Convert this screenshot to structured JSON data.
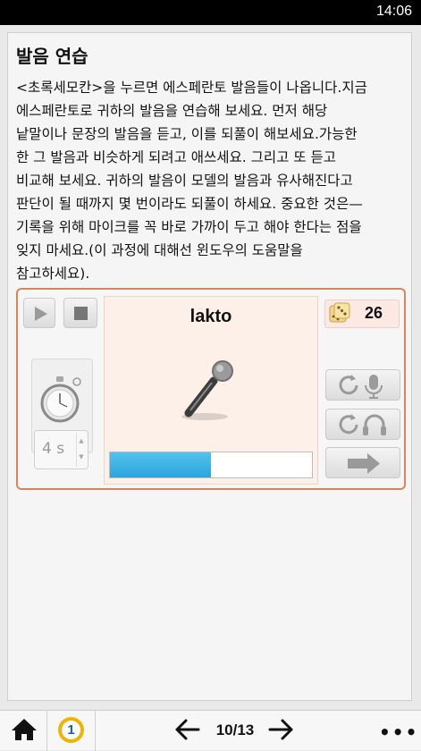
{
  "status_bar": {
    "time": "14:06"
  },
  "page": {
    "title": "발음 연습",
    "instructions": [
      "<초록세모칸>을 누르면  에스페란토 발음들이 나옵니다.지금",
      "에스페란토로 귀하의 발음을 연습해 보세요. 먼저 해당",
      "낱말이나 문장의 발음을 듣고, 이를 되풀이 해보세요.가능한",
      "한 그 발음과 비슷하게 되려고 애쓰세요. 그리고 또 듣고",
      "비교해 보세요. 귀하의 발음이 모델의 발음과 유사해진다고",
      "판단이 될 때까지 몇 번이라도 되풀이 하세요. 중요한 것은—",
      "기록을 위해 마이크를 꼭 바로 가까이 두고 해야 한다는 점을",
      "잊지 마세요.(이 과정에 대해선 윈도우의 도움말을",
      "참고하세요)."
    ]
  },
  "practice": {
    "word": "lakto",
    "dice_count": "26",
    "timer_value": "4 s",
    "progress_fraction": 0.5
  },
  "icons": {
    "play": "play-icon",
    "stop": "stop-icon",
    "stopwatch": "stopwatch-icon",
    "microphone": "microphone-icon",
    "dice": "dice-icon",
    "record_again": "replay-microphone-icon",
    "listen_again": "replay-headphones-icon",
    "next": "arrow-right-icon",
    "home": "home-icon",
    "more": "more-icon"
  },
  "bottom_nav": {
    "level": "1",
    "page_indicator": "10/13",
    "more_label": "•••"
  },
  "colors": {
    "panel_border": "#d9875a",
    "progress_fill": "#2aa6dc",
    "level_badge": "#f0b400"
  }
}
